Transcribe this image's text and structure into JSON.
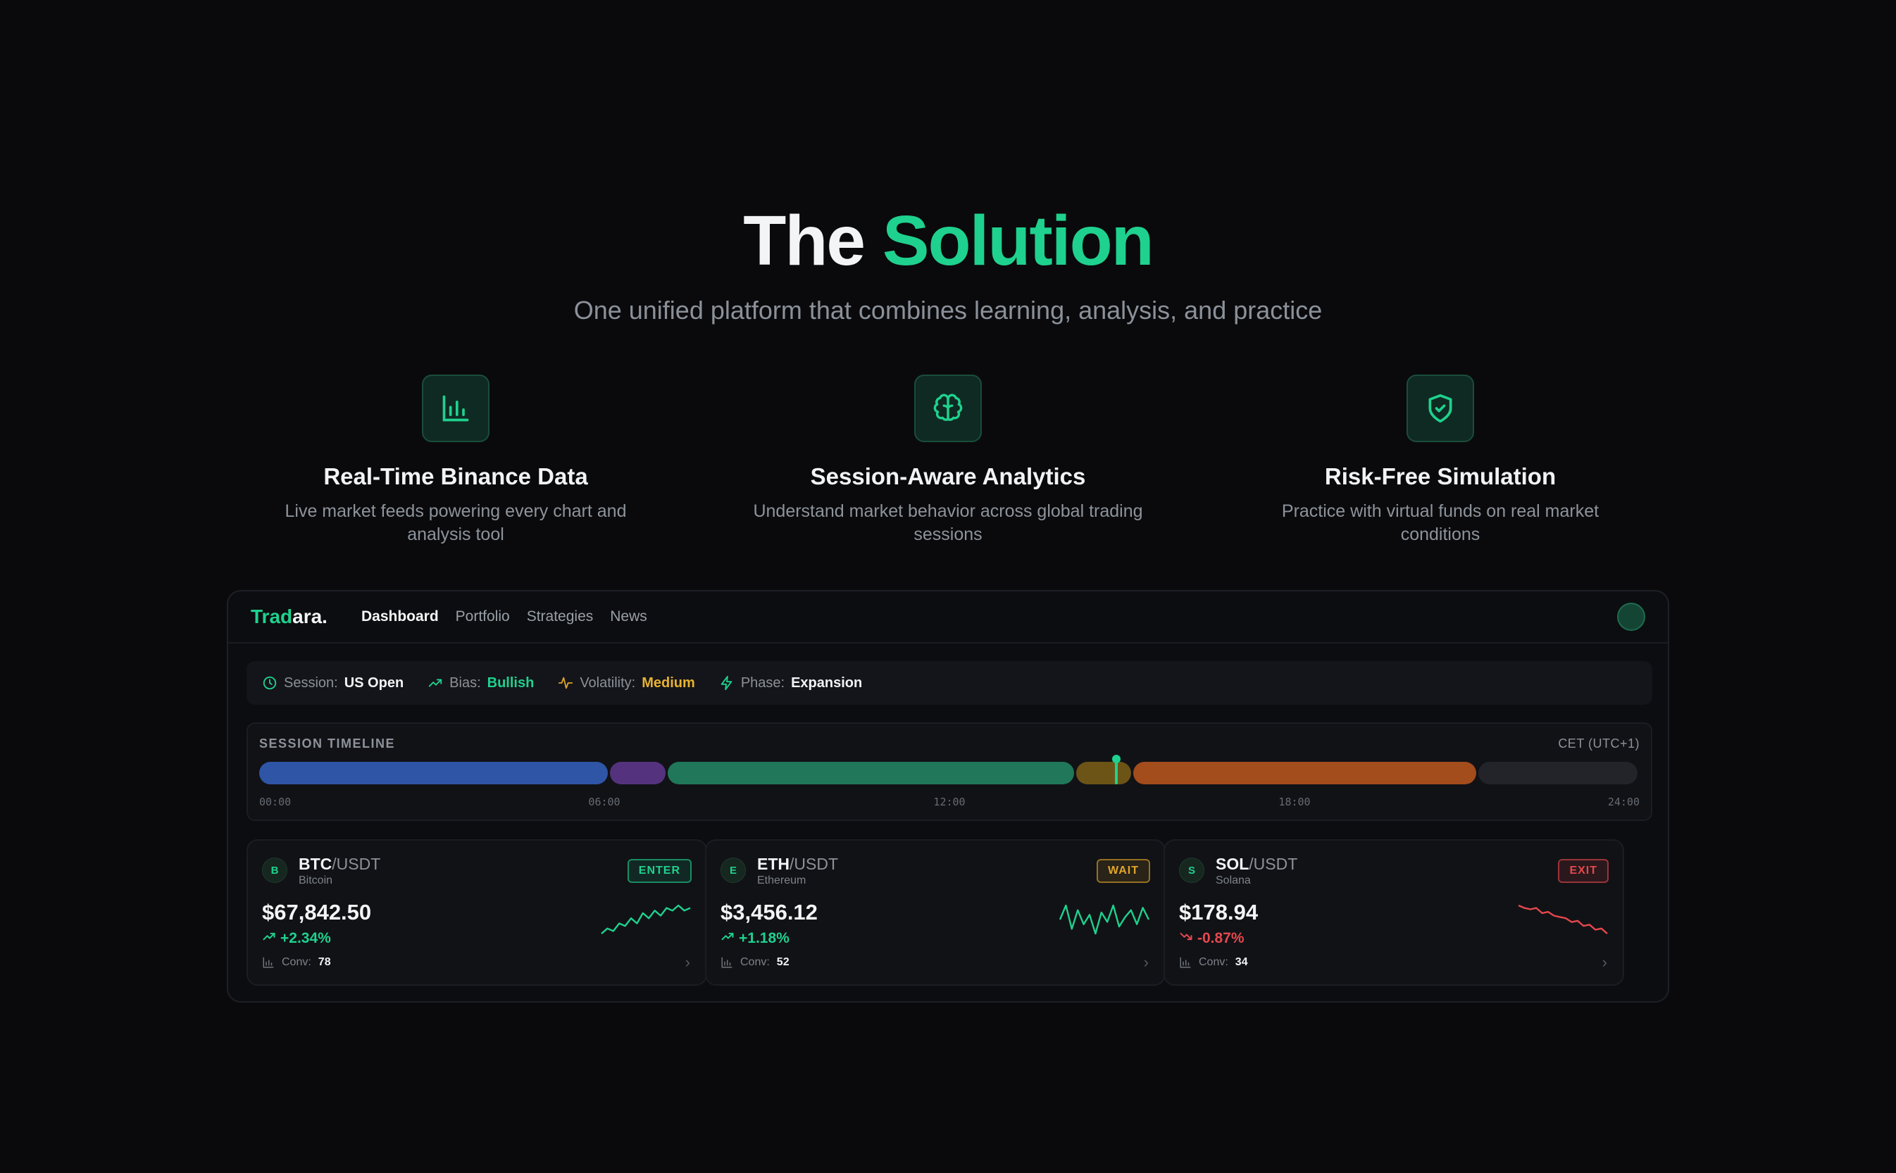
{
  "hero": {
    "title_plain": "The",
    "title_accent": "Solution",
    "subtitle": "One unified platform that combines learning, analysis, and practice"
  },
  "features": [
    {
      "icon": "bar-chart-icon",
      "title": "Real-Time Binance Data",
      "desc": "Live market feeds powering every chart and analysis tool"
    },
    {
      "icon": "brain-icon",
      "title": "Session-Aware Analytics",
      "desc": "Understand market behavior across global trading sessions"
    },
    {
      "icon": "shield-check-icon",
      "title": "Risk-Free Simulation",
      "desc": "Practice with virtual funds on real market conditions"
    }
  ],
  "app": {
    "logo_a": "Trad",
    "logo_b": "ara.",
    "nav": [
      "Dashboard",
      "Portfolio",
      "Strategies",
      "News"
    ],
    "status": {
      "session_label": "Session:",
      "session_value": "US Open",
      "bias_label": "Bias:",
      "bias_value": "Bullish",
      "volatility_label": "Volatility:",
      "volatility_value": "Medium",
      "phase_label": "Phase:",
      "phase_value": "Expansion"
    },
    "timeline": {
      "title": "SESSION TIMELINE",
      "timezone": "CET (UTC+1)",
      "ticks": [
        "00:00",
        "06:00",
        "12:00",
        "18:00",
        "24:00"
      ],
      "current_time_hours": 14.9,
      "segments": [
        {
          "start": 0,
          "end": 6.1,
          "color": "#2f56a6"
        },
        {
          "start": 6.1,
          "end": 7.1,
          "color": "#55327d"
        },
        {
          "start": 7.1,
          "end": 14.2,
          "color": "#20775a"
        },
        {
          "start": 14.2,
          "end": 15.2,
          "color": "#6b5416"
        },
        {
          "start": 15.2,
          "end": 21.2,
          "color": "#a34c1c"
        },
        {
          "start": 21.2,
          "end": 24,
          "color": "#22242a"
        }
      ]
    },
    "cards": [
      {
        "badge": "B",
        "base": "BTC",
        "quote": "/USDT",
        "name": "Bitcoin",
        "signal": "ENTER",
        "signal_color": "#1fd18e",
        "price": "$67,842.50",
        "change": "+2.34%",
        "direction": "up",
        "conv_label": "Conv:",
        "conv": "78",
        "spark": [
          3,
          5,
          4,
          7,
          6,
          9,
          7,
          11,
          9,
          12,
          10,
          13,
          12,
          14,
          12,
          13
        ]
      },
      {
        "badge": "E",
        "base": "ETH",
        "quote": "/USDT",
        "name": "Ethereum",
        "signal": "WAIT",
        "signal_color": "#e0a52a",
        "price": "$3,456.12",
        "change": "+1.18%",
        "direction": "up",
        "conv_label": "Conv:",
        "conv": "52",
        "spark": [
          8,
          8.6,
          7.6,
          8.4,
          7.8,
          8.2,
          7.4,
          8.3,
          7.9,
          8.6,
          7.7,
          8.1,
          8.4,
          7.8,
          8.5,
          8
        ]
      },
      {
        "badge": "S",
        "base": "SOL",
        "quote": "/USDT",
        "name": "Solana",
        "signal": "EXIT",
        "signal_color": "#e5484d",
        "price": "$178.94",
        "change": "-0.87%",
        "direction": "down",
        "conv_label": "Conv:",
        "conv": "34",
        "spark": [
          14,
          13,
          12.5,
          13,
          11,
          11.5,
          10,
          9.5,
          9,
          7.5,
          8,
          6,
          6.5,
          4.5,
          5,
          3
        ]
      }
    ]
  }
}
